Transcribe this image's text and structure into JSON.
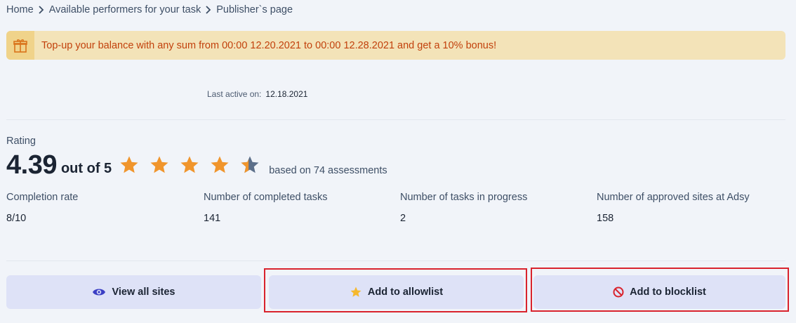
{
  "breadcrumb": {
    "items": [
      "Home",
      "Available performers for your task",
      "Publisher`s page"
    ]
  },
  "banner": {
    "icon": "gift-icon",
    "text": "Top-up your balance with any sum from 00:00 12.20.2021 to 00:00 12.28.2021 and get a 10% bonus!",
    "text_color": "#c2410c",
    "bg_color": "#f3e3b8"
  },
  "last_active": {
    "label": "Last active on:",
    "value": "12.18.2021"
  },
  "rating": {
    "label": "Rating",
    "value": "4.39",
    "out_of": "out of 5",
    "stars_filled": 4.39,
    "based_on": "based on 74 assessments",
    "star_color": "#f0952c",
    "star_empty_color": "#5c6f8a"
  },
  "stats": [
    {
      "label": "Completion rate",
      "value": "8/10"
    },
    {
      "label": "Number of completed tasks",
      "value": "141"
    },
    {
      "label": "Number of tasks in progress",
      "value": "2"
    },
    {
      "label": "Number of approved sites at Adsy",
      "value": "158"
    }
  ],
  "buttons": {
    "view_all_sites": {
      "label": "View all sites",
      "icon": "eye-icon"
    },
    "add_to_allowlist": {
      "label": "Add to allowlist",
      "icon": "star-icon"
    },
    "add_to_blocklist": {
      "label": "Add to blocklist",
      "icon": "block-icon"
    }
  },
  "highlight_color": "#d9232d"
}
